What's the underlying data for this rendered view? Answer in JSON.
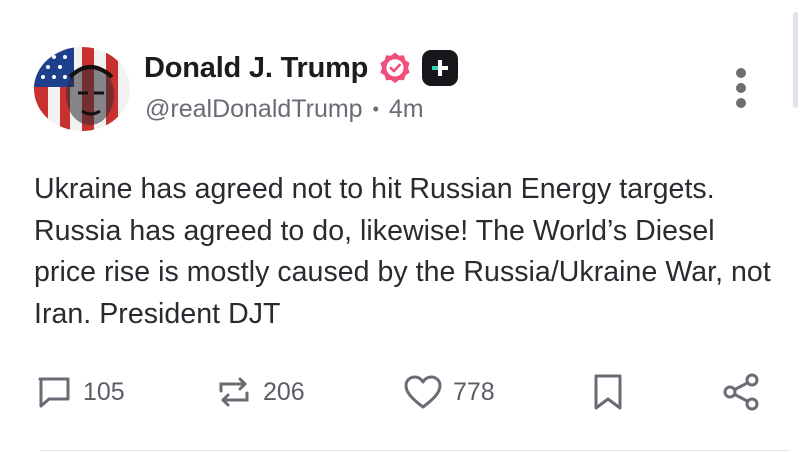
{
  "author": {
    "display_name": "Donald J. Trump",
    "handle": "@realDonaldTrump",
    "time_ago": "4m",
    "separator": "•"
  },
  "post": {
    "text": "Ukraine has agreed not to hit Russian Energy targets. Russia has agreed to do, likewise! The World’s Diesel price rise is mostly caused by the Russia/Ukraine War, not Iran. President DJT"
  },
  "actions": {
    "replies": "105",
    "reposts": "206",
    "likes": "778"
  },
  "icons": {
    "verified": "verified-badge-icon",
    "plus": "plus-badge-icon",
    "more": "more-options-icon",
    "reply": "reply-icon",
    "repost": "repost-icon",
    "like": "heart-icon",
    "bookmark": "bookmark-icon",
    "share": "share-icon"
  },
  "colors": {
    "verified_badge": "#f0507c",
    "icon_gray": "#6b6b75",
    "text": "#2a2a30"
  }
}
